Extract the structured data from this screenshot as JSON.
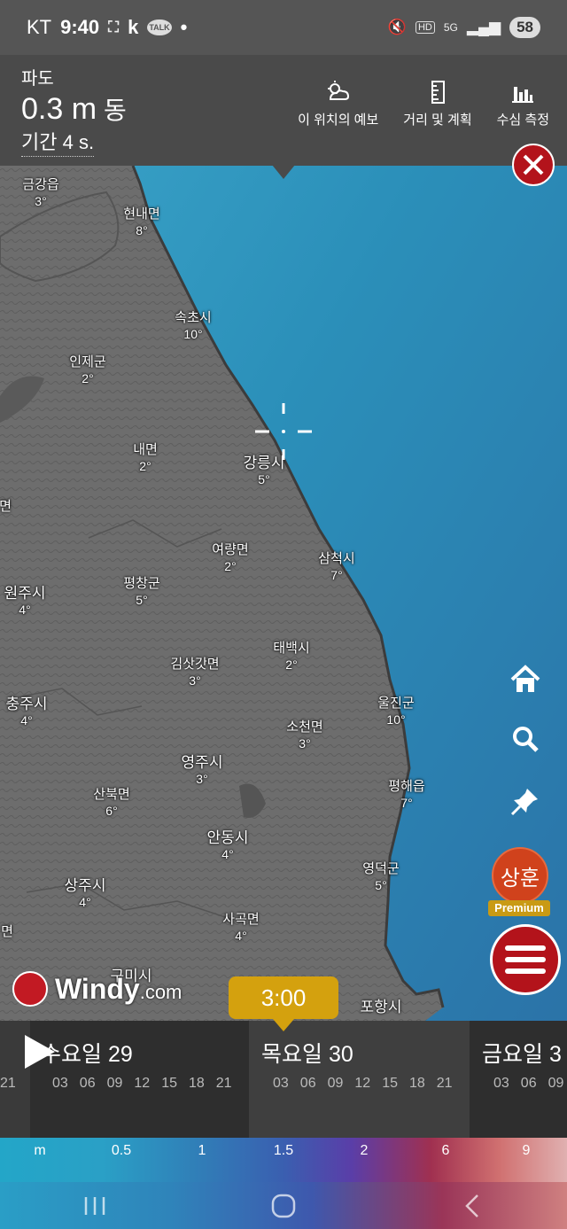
{
  "status_bar": {
    "carrier": "KT",
    "time": "9:40",
    "app_k": "k",
    "talk": "TALK",
    "dot": "•",
    "hd": "HD",
    "net": "5G",
    "battery": "58"
  },
  "wave": {
    "title": "파도",
    "value": "0.3 m",
    "direction": "동",
    "period": "기간 4 s."
  },
  "tools": [
    {
      "label": "이 위치의 예보",
      "icon": "forecast-icon"
    },
    {
      "label": "거리 및 계획",
      "icon": "ruler-icon"
    },
    {
      "label": "수심 측정",
      "icon": "depth-chart-icon"
    }
  ],
  "places": [
    {
      "name": "금강읍",
      "temp": "3°"
    },
    {
      "name": "현내면",
      "temp": "8°"
    },
    {
      "name": "속초시",
      "temp": "10°"
    },
    {
      "name": "인제군",
      "temp": "2°"
    },
    {
      "name": "내면",
      "temp": "2°"
    },
    {
      "name": "강릉시",
      "temp": "5°"
    },
    {
      "name": "여량면",
      "temp": "2°"
    },
    {
      "name": "삼척시",
      "temp": "7°"
    },
    {
      "name": "평창군",
      "temp": "5°"
    },
    {
      "name": "원주시",
      "temp": "4°"
    },
    {
      "name": "태백시",
      "temp": "2°"
    },
    {
      "name": "김삿갓면",
      "temp": "3°"
    },
    {
      "name": "충주시",
      "temp": "4°"
    },
    {
      "name": "울진군",
      "temp": "10°"
    },
    {
      "name": "소천면",
      "temp": "3°"
    },
    {
      "name": "영주시",
      "temp": "3°"
    },
    {
      "name": "산북면",
      "temp": "6°"
    },
    {
      "name": "평해읍",
      "temp": "7°"
    },
    {
      "name": "안동시",
      "temp": "4°"
    },
    {
      "name": "영덕군",
      "temp": "5°"
    },
    {
      "name": "상주시",
      "temp": "4°"
    },
    {
      "name": "사곡면",
      "temp": "4°"
    },
    {
      "name": "구미시",
      "temp": ""
    },
    {
      "name": "포항시",
      "temp": ""
    },
    {
      "name": "면",
      "temp": ""
    },
    {
      "name": "면",
      "temp": ""
    }
  ],
  "avatar": {
    "name": "상훈",
    "badge": "Premium"
  },
  "logo": {
    "word": "Windy",
    "suffix": ".com"
  },
  "time_badge": "3:00",
  "timeline": {
    "prev_hour": "21",
    "days": [
      {
        "name": "수요일 29",
        "hours": [
          "03",
          "06",
          "09",
          "12",
          "15",
          "18",
          "21"
        ]
      },
      {
        "name": "목요일 30",
        "hours": [
          "03",
          "06",
          "09",
          "12",
          "15",
          "18",
          "21"
        ]
      },
      {
        "name": "금요일 3",
        "hours": [
          "03",
          "06",
          "09"
        ]
      }
    ]
  },
  "legend": {
    "unit": "m",
    "labels": [
      "0.5",
      "1",
      "1.5",
      "2",
      "6",
      "9"
    ]
  }
}
